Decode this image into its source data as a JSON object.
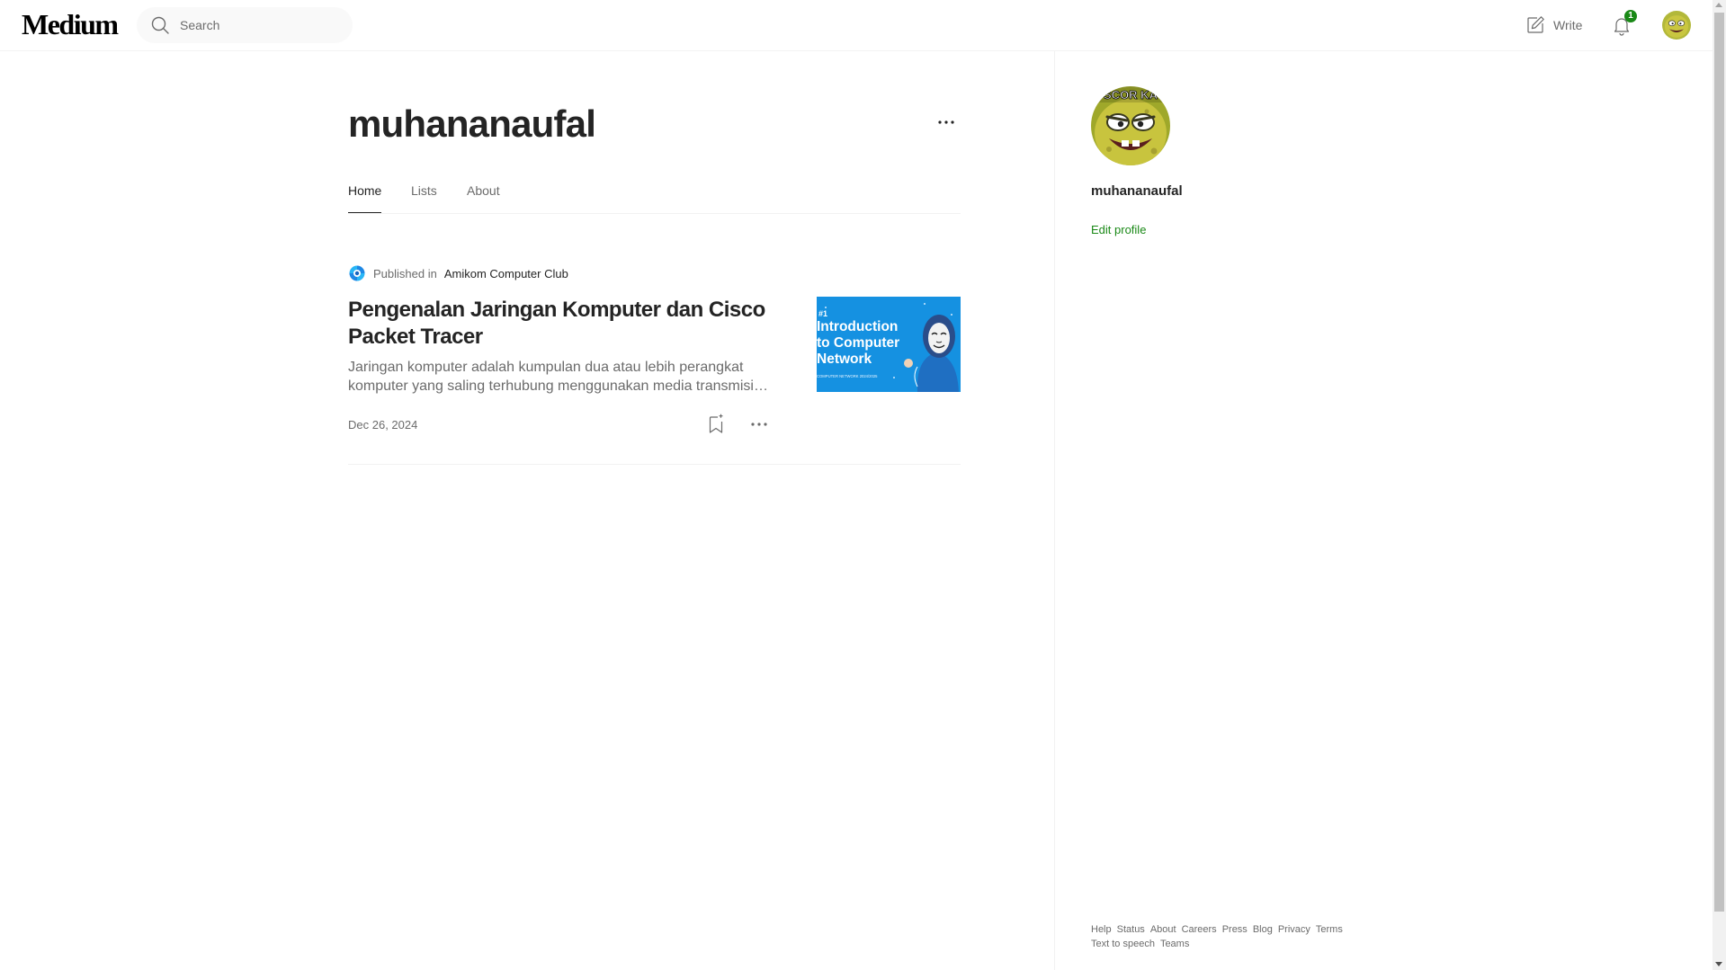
{
  "header": {
    "logo": "Medium",
    "search": {
      "placeholder": "Search",
      "value": ""
    },
    "write_label": "Write",
    "notifications_count": "1"
  },
  "profile": {
    "name": "muhananaufal",
    "tabs": [
      {
        "label": "Home",
        "active": true
      },
      {
        "label": "Lists",
        "active": false
      },
      {
        "label": "About",
        "active": false
      }
    ]
  },
  "post": {
    "published_prefix": "Published in",
    "publication": "Amikom Computer Club",
    "title": "Pengenalan Jaringan Komputer dan Cisco Packet Tracer",
    "subtitle": "Jaringan komputer adalah kumpulan dua atau lebih perangkat komputer yang saling terhubung menggunakan media transmisi untuk berbagi data dan sumber daya.",
    "date": "Dec 26, 2024",
    "thumbnail": {
      "tag": "#1",
      "headline_lines": [
        "Introduction",
        "to Computer",
        "Network"
      ],
      "caption": "COMPUTER NETWORK 2024/2025",
      "bg_color": "#1a9be8"
    }
  },
  "sidebar": {
    "name": "muhananaufal",
    "edit_label": "Edit profile",
    "avatar_caption": "SCOR KA",
    "footer_links": [
      "Help",
      "Status",
      "About",
      "Careers",
      "Press",
      "Blog",
      "Privacy",
      "Terms",
      "Text to speech",
      "Teams"
    ]
  },
  "colors": {
    "accent_green": "#1a8917",
    "text_primary": "#242424",
    "text_secondary": "#6b6b6b"
  }
}
